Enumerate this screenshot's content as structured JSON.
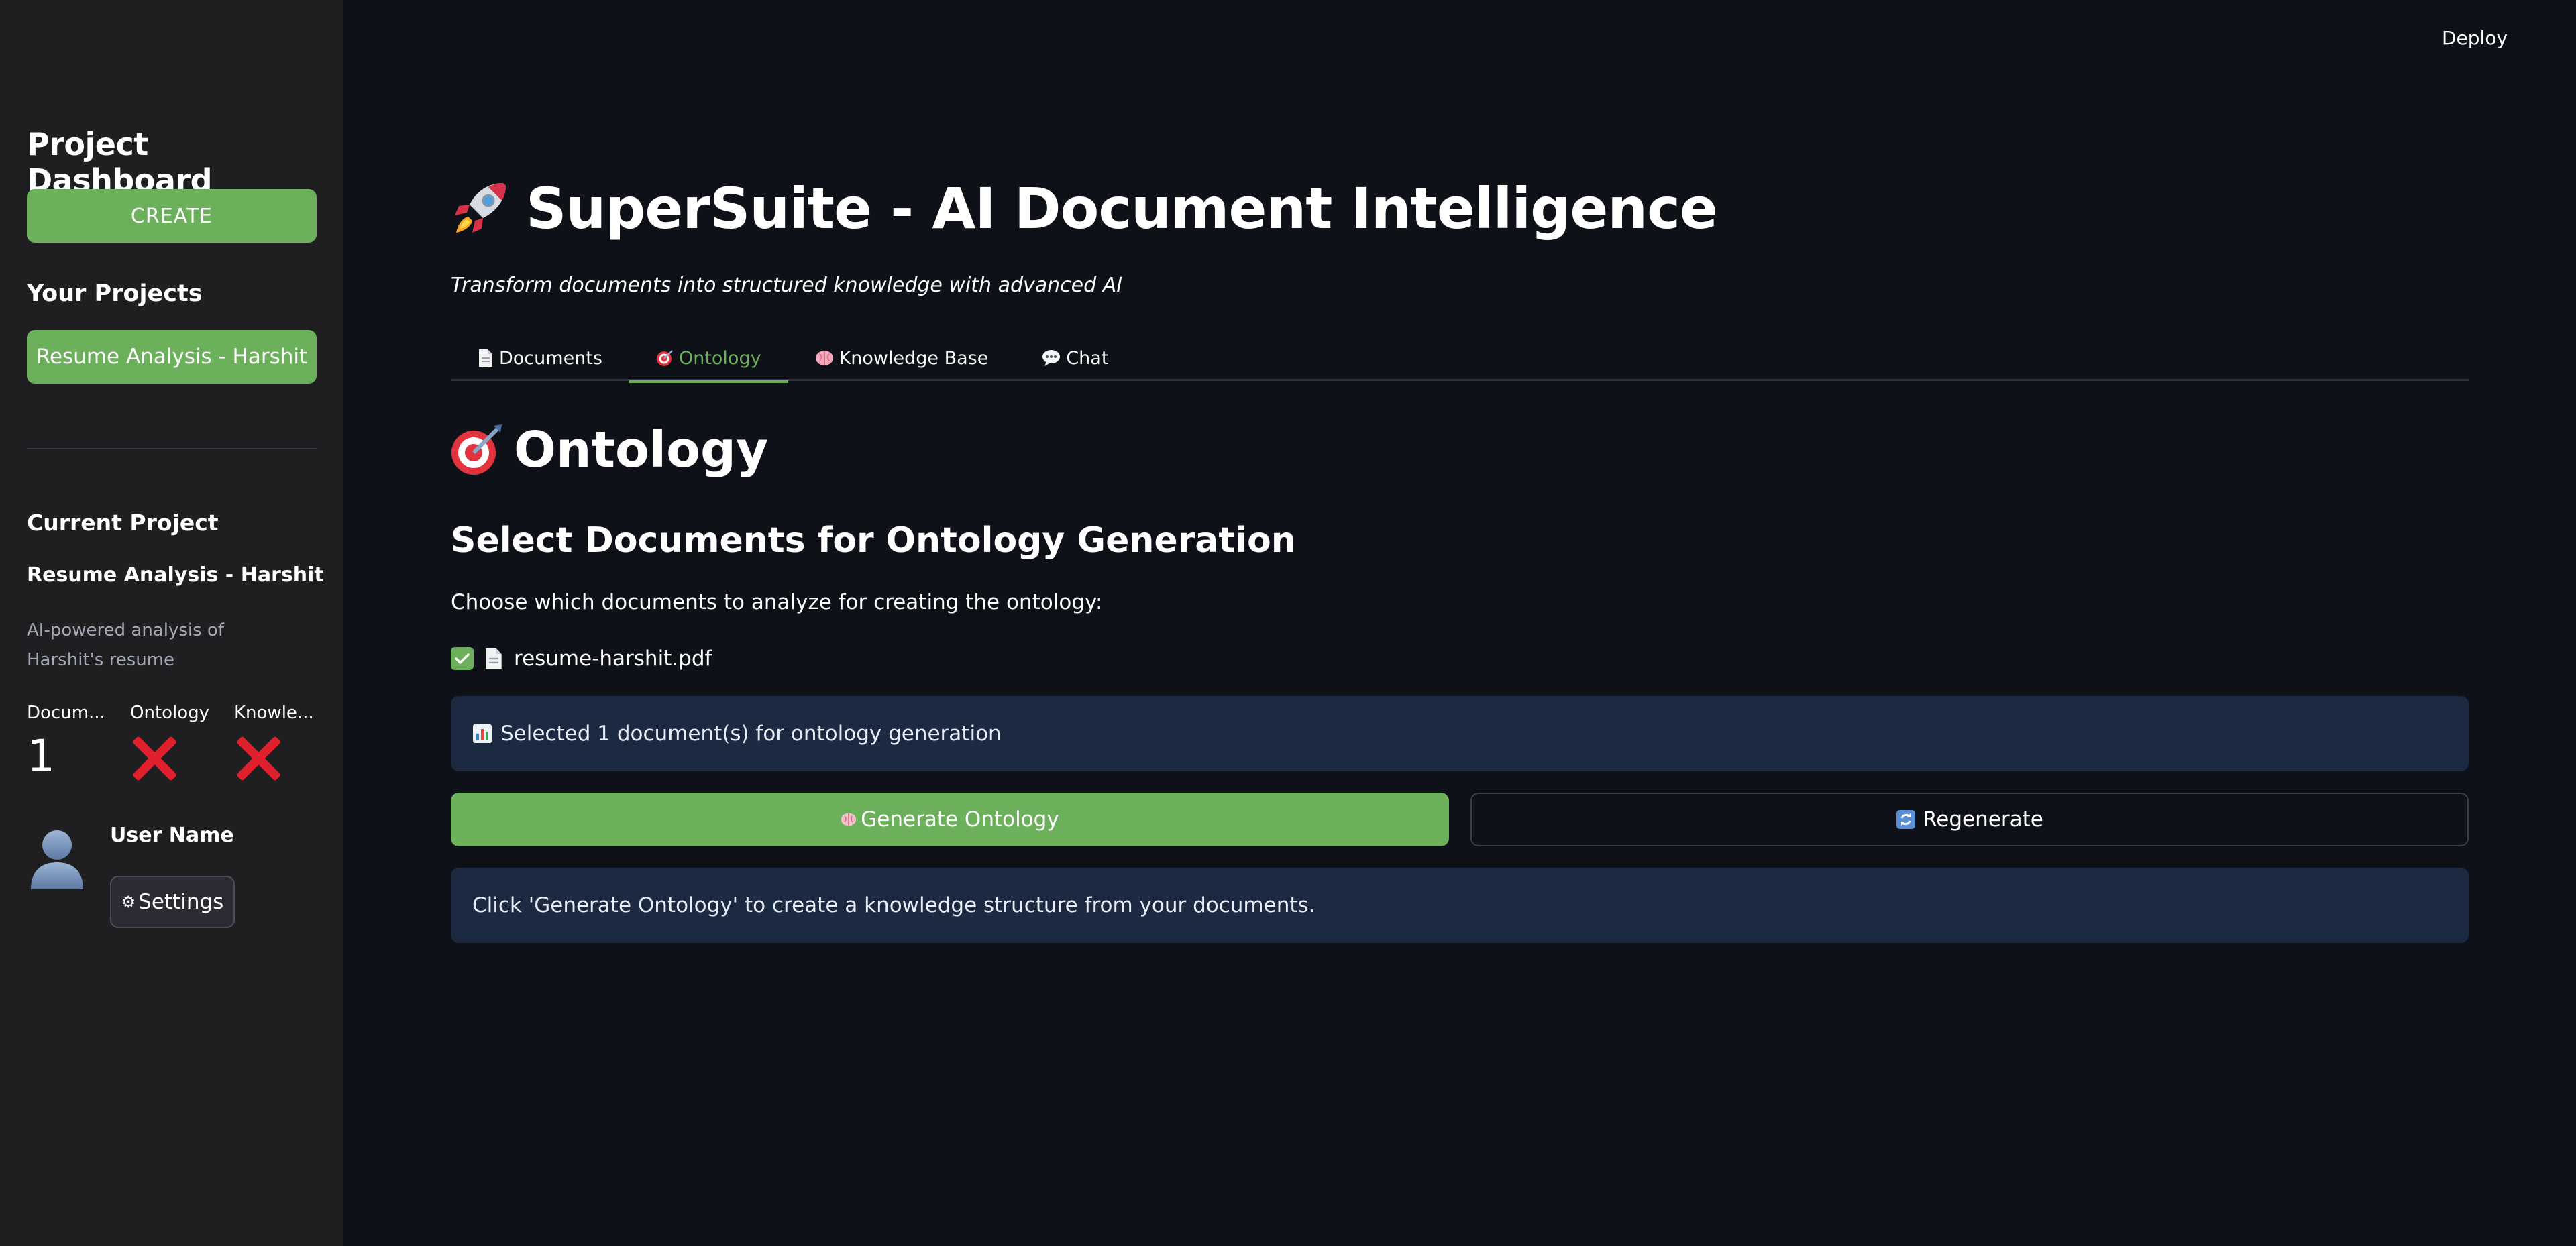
{
  "header": {
    "deploy_label": "Deploy"
  },
  "sidebar": {
    "title": "Project Dashboard",
    "create_label": "CREATE",
    "your_projects_label": "Your Projects",
    "projects": [
      {
        "label": "Resume Analysis - Harshit"
      }
    ],
    "current_project": {
      "heading": "Current Project",
      "name": "Resume Analysis - Harshit",
      "description": "AI-powered analysis of Harshit's resume",
      "metrics": [
        {
          "label": "Docum...",
          "value": "1"
        },
        {
          "label": "Ontology",
          "value": null,
          "status": "cross-mark"
        },
        {
          "label": "Knowle...",
          "value": null,
          "status": "cross-mark"
        }
      ]
    },
    "user": {
      "name": "User Name",
      "settings_label": "Settings"
    }
  },
  "main": {
    "title": "SuperSuite - AI Document Intelligence",
    "title_icon": "rocket-icon",
    "subtitle": "Transform documents into structured knowledge with advanced AI",
    "tabs": [
      {
        "label": "Documents",
        "icon": "page-icon",
        "active": false
      },
      {
        "label": "Ontology",
        "icon": "target-icon",
        "active": true
      },
      {
        "label": "Knowledge Base",
        "icon": "brain-icon",
        "active": false
      },
      {
        "label": "Chat",
        "icon": "speech-bubble-icon",
        "active": false
      }
    ],
    "section_title": "Ontology",
    "section_icon": "target-icon",
    "select_title": "Select Documents for Ontology Generation",
    "instruction": "Choose which documents to analyze for creating the ontology:",
    "documents": [
      {
        "name": "resume-harshit.pdf",
        "checked": true
      }
    ],
    "selected_info": "Selected 1 document(s) for ontology generation",
    "generate_label": "Generate Ontology",
    "regenerate_label": "Regenerate",
    "hint": "Click 'Generate Ontology' to create a knowledge structure from your documents."
  },
  "colors": {
    "accent": "#6cb05c",
    "background": "#0e1117",
    "sidebar": "#1f1f22",
    "info_box": "#1c2a41",
    "error": "#e0202c"
  }
}
